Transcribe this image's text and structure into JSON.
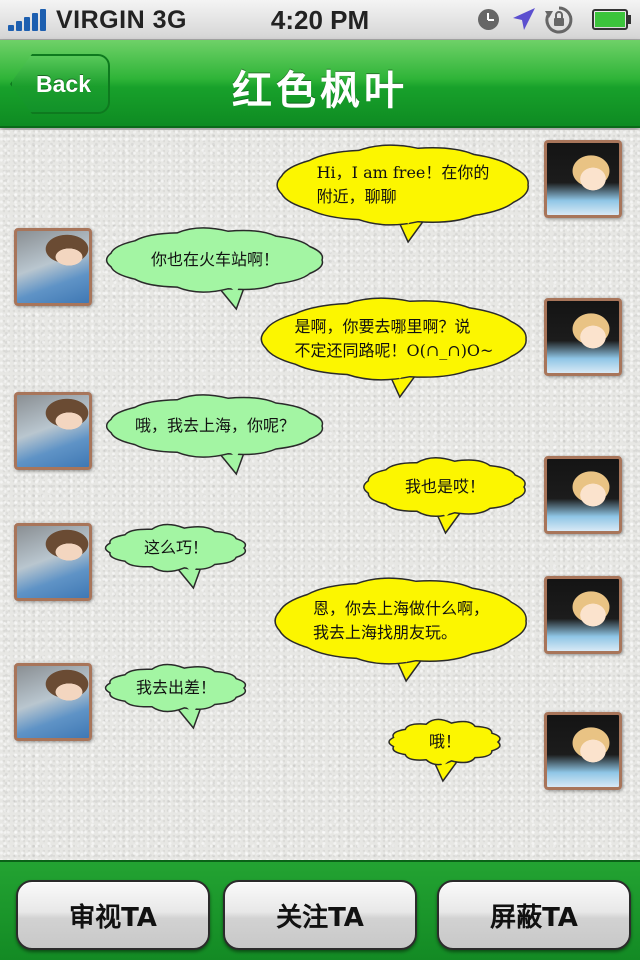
{
  "status_bar": {
    "carrier": "VIRGIN",
    "network": "3G",
    "time": "4:20 PM",
    "icons": [
      "signal-icon",
      "clock-icon",
      "location-icon",
      "rotation-lock-icon",
      "battery-icon"
    ]
  },
  "nav": {
    "back_label": "Back",
    "title": "红色枫叶",
    "accent_color": "#1aa12c"
  },
  "colors": {
    "outgoing_bubble": "#fcf600",
    "incoming_bubble": "#a3f5a3",
    "bubble_outline": "#2a2a2a"
  },
  "messages": [
    {
      "side": "right",
      "text": "Hi，I am free！在你的\n附近，聊聊"
    },
    {
      "side": "left",
      "text": "你也在火车站啊！"
    },
    {
      "side": "right",
      "text": "是啊，你要去哪里啊？说\n不定还同路呢！O(∩_∩)O~"
    },
    {
      "side": "left",
      "text": "哦，我去上海，你呢？"
    },
    {
      "side": "right",
      "text": "我也是哎！"
    },
    {
      "side": "left",
      "text": "这么巧！"
    },
    {
      "side": "right",
      "text": "恩，你去上海做什么啊，\n我去上海找朋友玩。"
    },
    {
      "side": "left",
      "text": "我去出差！"
    },
    {
      "side": "right",
      "text": "哦！"
    }
  ],
  "toolbar": {
    "review_label": "审视TA",
    "follow_label": "关注TA",
    "block_label": "屏蔽TA"
  }
}
